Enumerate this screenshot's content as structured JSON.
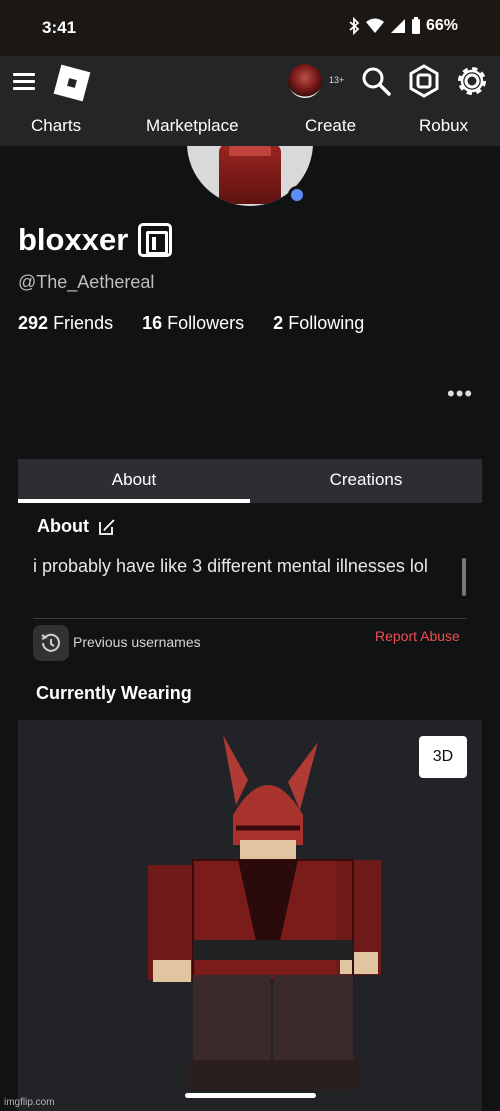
{
  "status_bar": {
    "time": "3:41",
    "battery": "66%"
  },
  "topbar": {
    "age_badge": "13+"
  },
  "nav": {
    "items": [
      "Charts",
      "Marketplace",
      "Create",
      "Robux"
    ]
  },
  "profile": {
    "display_name": "bloxxer",
    "handle": "@The_Aethereal",
    "friends_count": "292",
    "friends_label": "Friends",
    "followers_count": "16",
    "followers_label": "Followers",
    "following_count": "2",
    "following_label": "Following",
    "more_label": "•••"
  },
  "tabs": [
    {
      "label": "About",
      "active": true
    },
    {
      "label": "Creations",
      "active": false
    }
  ],
  "about": {
    "title": "About",
    "text": "i probably have like 3 different mental illnesses lol",
    "previous_usernames": "Previous usernames",
    "report_abuse": "Report Abuse"
  },
  "wearing": {
    "title": "Currently Wearing",
    "view_3d": "3D"
  },
  "watermark": "imgflip.com",
  "colors": {
    "background": "#111214",
    "panel": "#212326",
    "topbar": "#232527",
    "online": "#5c8df6",
    "report": "#f05050"
  }
}
